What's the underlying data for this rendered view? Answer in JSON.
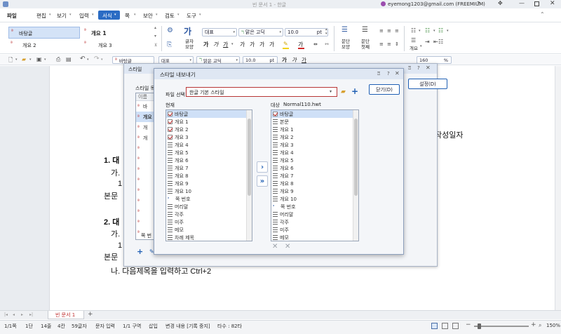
{
  "titlebar": {
    "title": "빈 문서 1 - 한글",
    "account": "eyemong1203@gmail.com (FREEMIUM)"
  },
  "menu": {
    "items": [
      "파일",
      "편집",
      "보기",
      "입력",
      "서식",
      "쪽",
      "보안",
      "검토",
      "도구"
    ],
    "active": "서식"
  },
  "ribbon": {
    "styles": [
      "바탕글",
      "개요 1",
      "개요 2",
      "개요 3"
    ],
    "char_style_label": "글자\n모양",
    "para_label": "문단\n모양",
    "para_bullet_label": "문단\n첫째",
    "outline_label": "개요",
    "style_select": "대표",
    "font_select": "맑은 고딕",
    "size_value": "10.0",
    "size_unit": "pt"
  },
  "toolbar": {
    "style_select": "바탕글",
    "lang_select": "대표",
    "font_select": "맑은 고딕",
    "size_value": "10.0",
    "size_unit": "pt",
    "zoom_value": "160",
    "zoom_unit": "%"
  },
  "document": {
    "right_text": "작성일자",
    "lines": [
      "1. 대",
      "가.",
      "1",
      "본문",
      "2. 대",
      "가.",
      "1",
      "본문",
      "나.  다음제목을  입력하고  Ctrl+2"
    ]
  },
  "style_dialog": {
    "title": "스타일",
    "list_label": "스타일 목",
    "col_header": "이름",
    "items": [
      "바",
      "개요",
      "개",
      "개",
      "",
      "",
      "",
      "",
      "",
      "",
      "",
      "",
      "",
      "쪽 번"
    ],
    "settings_button": "설정(D)"
  },
  "export_dialog": {
    "title": "스타일 내보내기",
    "file_label": "파일 선택",
    "file_value": "한글 기본 스타일",
    "close_button": "닫기(D)",
    "current_label": "현재",
    "target_label": "대상",
    "target_file": "Normal110.hwt",
    "left_items": [
      "바탕글",
      "개요 1",
      "개요 2",
      "개요 3",
      "개요 4",
      "개요 5",
      "개요 6",
      "개요 7",
      "개요 8",
      "개요 9",
      "개요 10",
      "쪽 번호",
      "머리말",
      "각주",
      "미주",
      "메모",
      "차례 제목"
    ],
    "right_items": [
      "바탕글",
      "본문",
      "개요 1",
      "개요 2",
      "개요 3",
      "개요 4",
      "개요 5",
      "개요 6",
      "개요 7",
      "개요 8",
      "개요 9",
      "개요 10",
      "쪽 번호",
      "머리말",
      "각주",
      "미주",
      "메모"
    ]
  },
  "tabs": {
    "doc_tab": "빈 문서 1",
    "add": "+"
  },
  "statusbar": {
    "items": [
      "1/1쪽",
      "1단",
      "14줄",
      "4칸",
      "59글자",
      "문자 입력",
      "1/1 구역",
      "삽입",
      "변경 내용 [기록 중지]",
      "타수 : 82타"
    ],
    "zoom": "150%"
  },
  "colors": {
    "accent": "#1f5fb4",
    "menu_active_bg": "#2b6cc4",
    "dialog_title_bg": "#dfe7f3",
    "highlight_red": "#c02a2a"
  }
}
